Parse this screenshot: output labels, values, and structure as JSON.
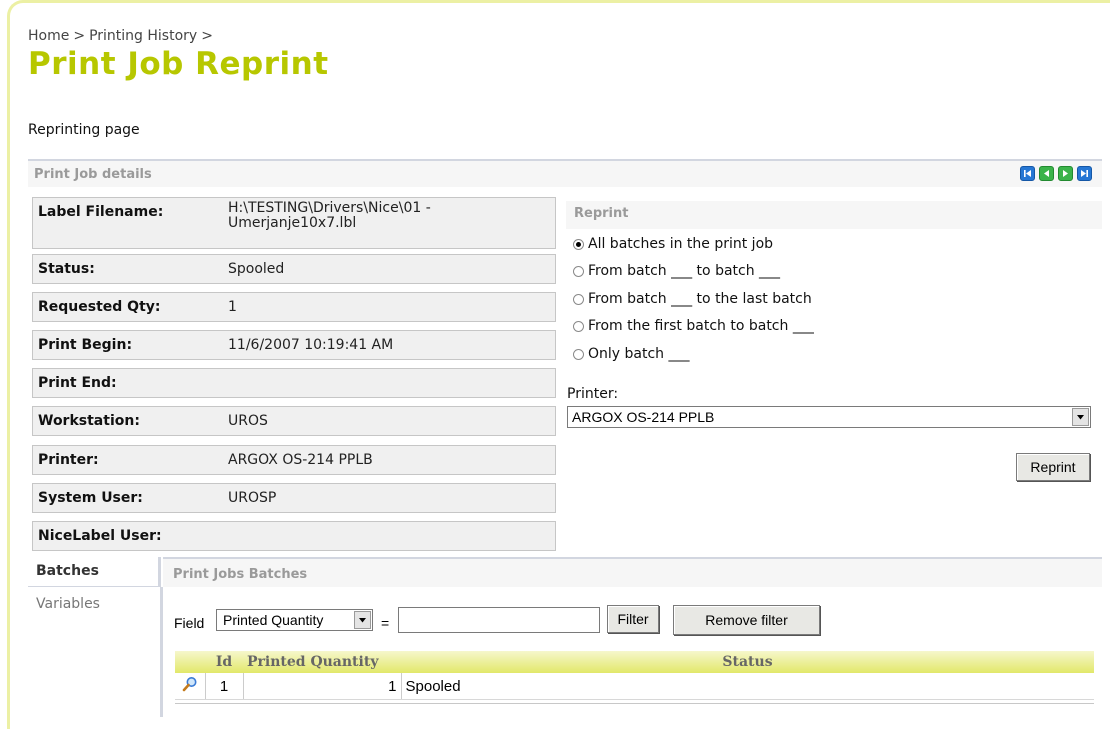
{
  "breadcrumb": {
    "items": [
      "Home",
      "Printing History"
    ],
    "separator": ">"
  },
  "page_title": "Print Job Reprint",
  "subtitle": "Reprinting page",
  "details_section": {
    "title": "Print Job details"
  },
  "nav_icons": [
    "first-icon",
    "prev-icon",
    "next-icon",
    "last-icon"
  ],
  "details": [
    {
      "key": "Label Filename:",
      "value": "H:\\TESTING\\Drivers\\Nice\\01 - Umerjanje10x7.lbl"
    },
    {
      "key": "Status:",
      "value": "Spooled"
    },
    {
      "key": "Requested Qty:",
      "value": "1"
    },
    {
      "key": "Print Begin:",
      "value": "11/6/2007 10:19:41 AM"
    },
    {
      "key": "Print End:",
      "value": ""
    },
    {
      "key": "Workstation:",
      "value": "UROS"
    },
    {
      "key": "Printer:",
      "value": "ARGOX OS-214 PPLB"
    },
    {
      "key": "System User:",
      "value": "UROSP"
    },
    {
      "key": "NiceLabel User:",
      "value": ""
    }
  ],
  "reprint": {
    "title": "Reprint",
    "options": [
      {
        "label": "All batches in the print job",
        "selected": true
      },
      {
        "label": "From batch ___ to batch ___",
        "selected": false
      },
      {
        "label": "From batch ___ to the last batch",
        "selected": false
      },
      {
        "label": "From the first batch to batch ___",
        "selected": false
      },
      {
        "label": "Only batch ___",
        "selected": false
      }
    ],
    "printer_label": "Printer:",
    "printer_value": "ARGOX OS-214 PPLB",
    "button": "Reprint"
  },
  "tabs": [
    "Batches",
    "Variables"
  ],
  "batches": {
    "title": "Print Jobs Batches",
    "field_label": "Field",
    "field_value": "Printed Quantity",
    "equals": "=",
    "filter_value": "",
    "filter_button": "Filter",
    "remove_filter_button": "Remove filter",
    "columns": [
      "Id",
      "Printed Quantity",
      "Status"
    ],
    "rows": [
      {
        "id": "1",
        "qty": "1",
        "status": "Spooled"
      }
    ]
  },
  "colors": {
    "accent": "#b7c700",
    "frame": "#ecf0a4",
    "nav_blue": "#2677d4",
    "nav_green": "#3bb34a"
  }
}
